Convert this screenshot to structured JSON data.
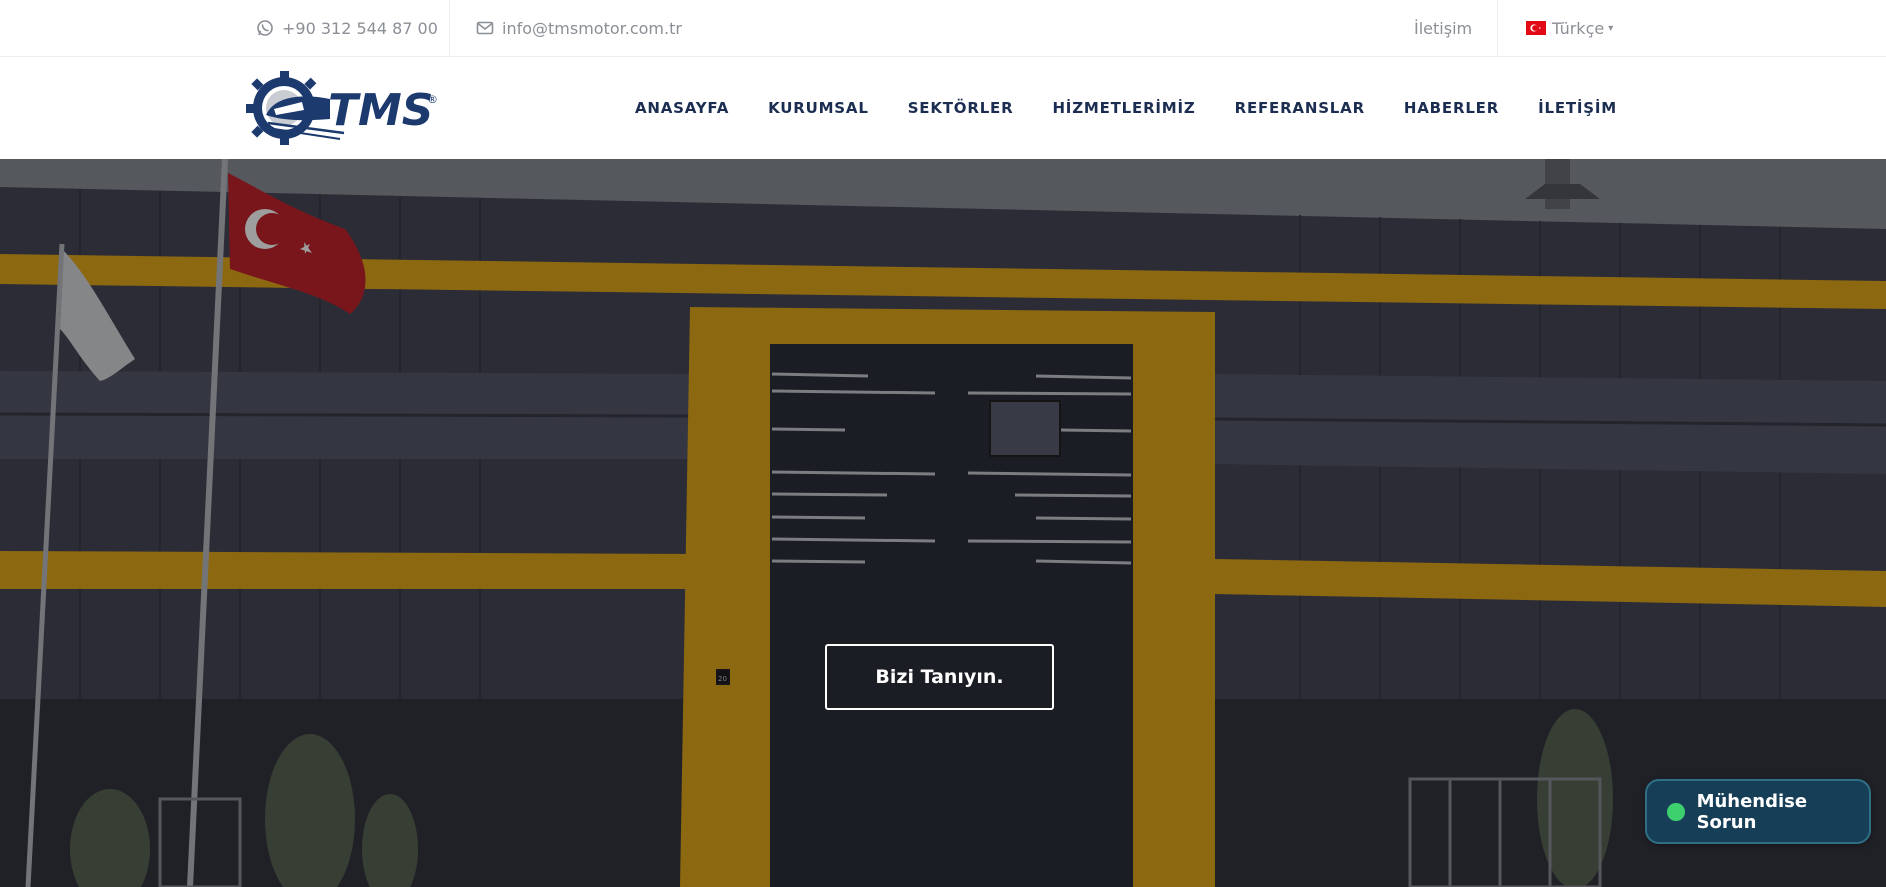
{
  "topbar": {
    "phone": "+90 312 544 87 00",
    "email": "info@tmsmotor.com.tr",
    "contact_link": "İletişim",
    "language": "Türkçe"
  },
  "logo": {
    "text": "TMS",
    "registered": "®"
  },
  "nav": {
    "items": [
      {
        "label": "ANASAYFA"
      },
      {
        "label": "KURUMSAL"
      },
      {
        "label": "SEKTÖRLER"
      },
      {
        "label": "HİZMETLERİMİZ"
      },
      {
        "label": "REFERANSLAR"
      },
      {
        "label": "HABERLER"
      },
      {
        "label": "İLETİŞİM"
      }
    ]
  },
  "hero": {
    "cta_label": "Bizi Tanıyın.",
    "door_number": "20"
  },
  "chat_widget": {
    "label": "Mühendise Sorun"
  },
  "colors": {
    "nav_text": "#1c2d52",
    "topbar_text": "#8b8f96",
    "building_accent": "#e2a81c",
    "flag_red": "#e30a17",
    "chat_bg": "#163f57",
    "chat_dot": "#3ecf6e"
  }
}
